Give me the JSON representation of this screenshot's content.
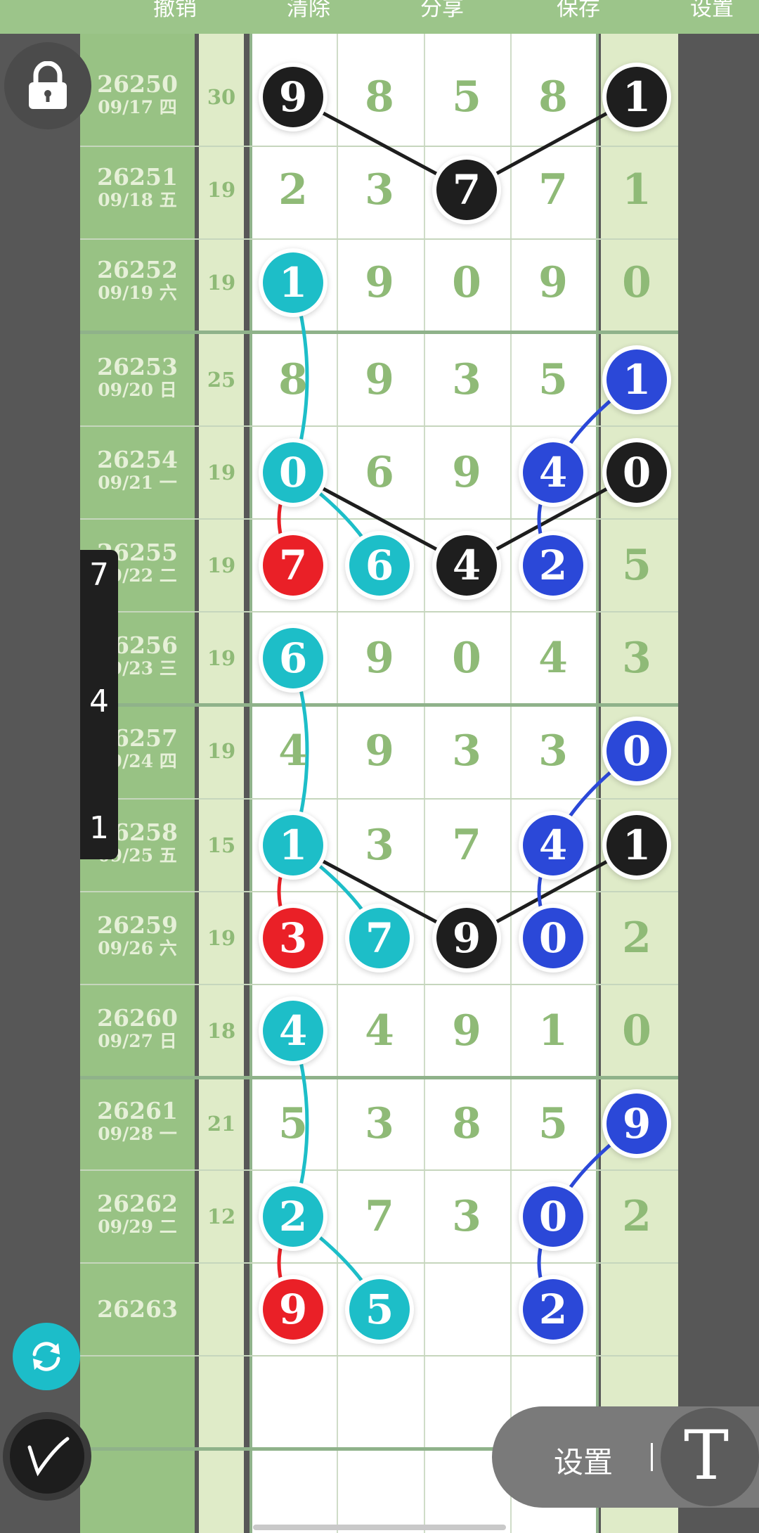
{
  "toolbar": {
    "undo_label": "撤销",
    "clear_label": "清除",
    "share_label": "分享",
    "save_label": "保存",
    "settings_label": "设置"
  },
  "rows": [
    {
      "issue": "26250",
      "date": "09/17 四",
      "sum": "30",
      "d": [
        "9",
        "8",
        "5",
        "8",
        "1"
      ]
    },
    {
      "issue": "26251",
      "date": "09/18 五",
      "sum": "19",
      "d": [
        "2",
        "3",
        "7",
        "7",
        "1"
      ]
    },
    {
      "issue": "26252",
      "date": "09/19 六",
      "sum": "19",
      "d": [
        "1",
        "9",
        "0",
        "9",
        "0"
      ]
    },
    {
      "issue": "26253",
      "date": "09/20 日",
      "sum": "25",
      "d": [
        "8",
        "9",
        "3",
        "5",
        "1"
      ]
    },
    {
      "issue": "26254",
      "date": "09/21 一",
      "sum": "19",
      "d": [
        "0",
        "6",
        "9",
        "4",
        "0"
      ]
    },
    {
      "issue": "26255",
      "date": "09/22 二",
      "sum": "19",
      "d": [
        "7",
        "6",
        "4",
        "2",
        "5"
      ]
    },
    {
      "issue": "26256",
      "date": "09/23 三",
      "sum": "19",
      "d": [
        "6",
        "9",
        "0",
        "4",
        "3"
      ]
    },
    {
      "issue": "26257",
      "date": "09/24 四",
      "sum": "19",
      "d": [
        "4",
        "9",
        "3",
        "3",
        "0"
      ]
    },
    {
      "issue": "26258",
      "date": "09/25 五",
      "sum": "15",
      "d": [
        "1",
        "3",
        "7",
        "4",
        "1"
      ]
    },
    {
      "issue": "26259",
      "date": "09/26 六",
      "sum": "19",
      "d": [
        "3",
        "7",
        "9",
        "0",
        "2"
      ]
    },
    {
      "issue": "26260",
      "date": "09/27 日",
      "sum": "18",
      "d": [
        "4",
        "4",
        "9",
        "1",
        "0"
      ]
    },
    {
      "issue": "26261",
      "date": "09/28 一",
      "sum": "21",
      "d": [
        "5",
        "3",
        "8",
        "5",
        "9"
      ]
    },
    {
      "issue": "26262",
      "date": "09/29 二",
      "sum": "12",
      "d": [
        "2",
        "7",
        "3",
        "0",
        "2"
      ]
    },
    {
      "issue": "26263",
      "date": "",
      "sum": "",
      "d": [
        "9",
        "5",
        "",
        "2",
        ""
      ]
    }
  ],
  "highlights": [
    {
      "row": 0,
      "col": 0,
      "color": "black"
    },
    {
      "row": 0,
      "col": 4,
      "color": "black"
    },
    {
      "row": 1,
      "col": 2,
      "color": "black"
    },
    {
      "row": 2,
      "col": 0,
      "color": "cyan"
    },
    {
      "row": 3,
      "col": 4,
      "color": "blue"
    },
    {
      "row": 4,
      "col": 0,
      "color": "cyan"
    },
    {
      "row": 4,
      "col": 3,
      "color": "blue"
    },
    {
      "row": 4,
      "col": 4,
      "color": "black"
    },
    {
      "row": 5,
      "col": 0,
      "color": "red"
    },
    {
      "row": 5,
      "col": 1,
      "color": "cyan"
    },
    {
      "row": 5,
      "col": 2,
      "color": "black"
    },
    {
      "row": 5,
      "col": 3,
      "color": "blue"
    },
    {
      "row": 6,
      "col": 0,
      "color": "cyan"
    },
    {
      "row": 7,
      "col": 4,
      "color": "blue"
    },
    {
      "row": 8,
      "col": 0,
      "color": "cyan"
    },
    {
      "row": 8,
      "col": 3,
      "color": "blue"
    },
    {
      "row": 8,
      "col": 4,
      "color": "black"
    },
    {
      "row": 9,
      "col": 0,
      "color": "red"
    },
    {
      "row": 9,
      "col": 1,
      "color": "cyan"
    },
    {
      "row": 9,
      "col": 2,
      "color": "black"
    },
    {
      "row": 9,
      "col": 3,
      "color": "blue"
    },
    {
      "row": 10,
      "col": 0,
      "color": "cyan"
    },
    {
      "row": 11,
      "col": 4,
      "color": "blue"
    },
    {
      "row": 12,
      "col": 0,
      "color": "cyan"
    },
    {
      "row": 12,
      "col": 3,
      "color": "blue"
    },
    {
      "row": 13,
      "col": 0,
      "color": "red"
    },
    {
      "row": 13,
      "col": 1,
      "color": "cyan"
    },
    {
      "row": 13,
      "col": 3,
      "color": "blue"
    }
  ],
  "side_panel": {
    "items": [
      "7",
      "4",
      "1"
    ]
  },
  "bottom_bar": {
    "settings_label": "设置",
    "text_tool_label": "T"
  },
  "icons": {
    "lock": "lock-icon",
    "refresh": "refresh-icon",
    "pen": "pen-icon"
  },
  "colors": {
    "black": "#1e1e1e",
    "cyan": "#1dbec8",
    "blue": "#2b48d8",
    "red": "#ea2027",
    "header_green": "#9cc58a",
    "digit_green": "#8fba77"
  }
}
